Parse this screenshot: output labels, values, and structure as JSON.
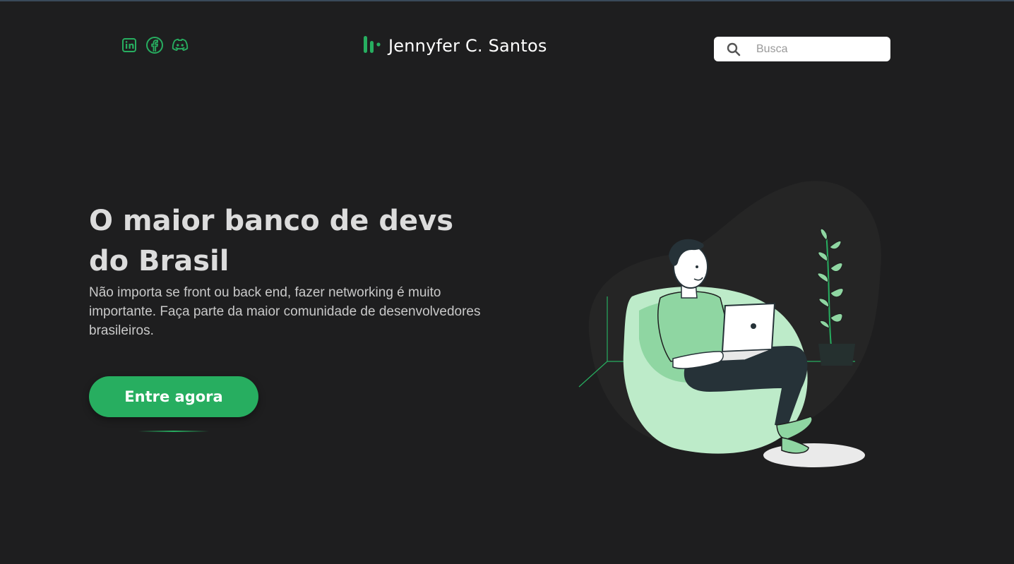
{
  "header": {
    "socials": [
      {
        "icon": "linkedin-icon"
      },
      {
        "icon": "facebook-icon"
      },
      {
        "icon": "discord-icon"
      }
    ],
    "brand": {
      "icon": "logo-icon",
      "name": "Jennyfer C. Santos"
    },
    "search": {
      "placeholder": "Busca",
      "icon": "search-icon"
    }
  },
  "hero": {
    "title_line1": "O maior banco de devs",
    "title_line2": "do Brasil",
    "description": "Não importa se front ou back end, fazer networking é muito importante. Faça parte da maior comunidade de desenvolvedores brasileiros.",
    "cta_label": "Entre agora"
  },
  "colors": {
    "accent": "#27ae60",
    "background": "#1e1e1f",
    "text": "#dcdcdc"
  }
}
